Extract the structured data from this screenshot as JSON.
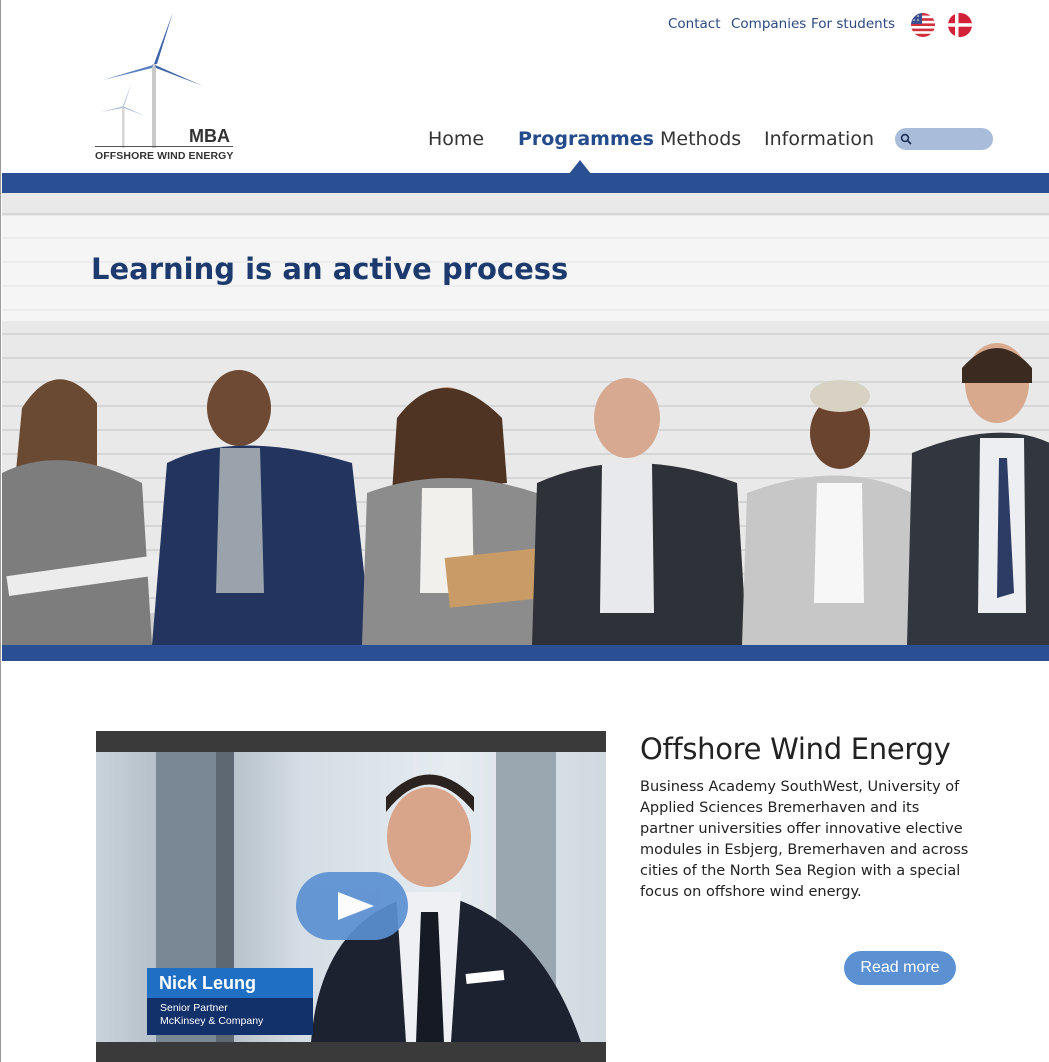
{
  "header": {
    "utility_links": [
      "Contact",
      "Companies",
      "For students"
    ],
    "languages": [
      {
        "name": "us-flag-icon"
      },
      {
        "name": "dk-flag-icon"
      }
    ],
    "logo": {
      "title": "MBA",
      "subtitle": "OFFSHORE WIND ENERGY"
    },
    "nav": {
      "items": [
        "Home",
        "Programmes",
        "Methods",
        "Information"
      ],
      "active": "Programmes"
    },
    "search": {
      "placeholder": "",
      "value": ""
    }
  },
  "hero": {
    "title": "Learning is an active process"
  },
  "video": {
    "person_name": "Nick Leung",
    "person_role": "Senior Partner",
    "person_company": "McKinsey & Company"
  },
  "article": {
    "title": "Offshore Wind Energy",
    "body": "Business Academy SouthWest, University of Applied Sciences Bremerhaven and its partner universities offer innovative elective modules in Esbjerg, Bremerhaven and across cities of the North Sea Region with a special focus on offshore wind energy.",
    "read_more": "Read more"
  },
  "colors": {
    "brand_blue": "#2b4f93",
    "title_blue": "#1c3a6e",
    "button_blue": "#5b90d2",
    "search_bg": "#a9bcd9"
  }
}
